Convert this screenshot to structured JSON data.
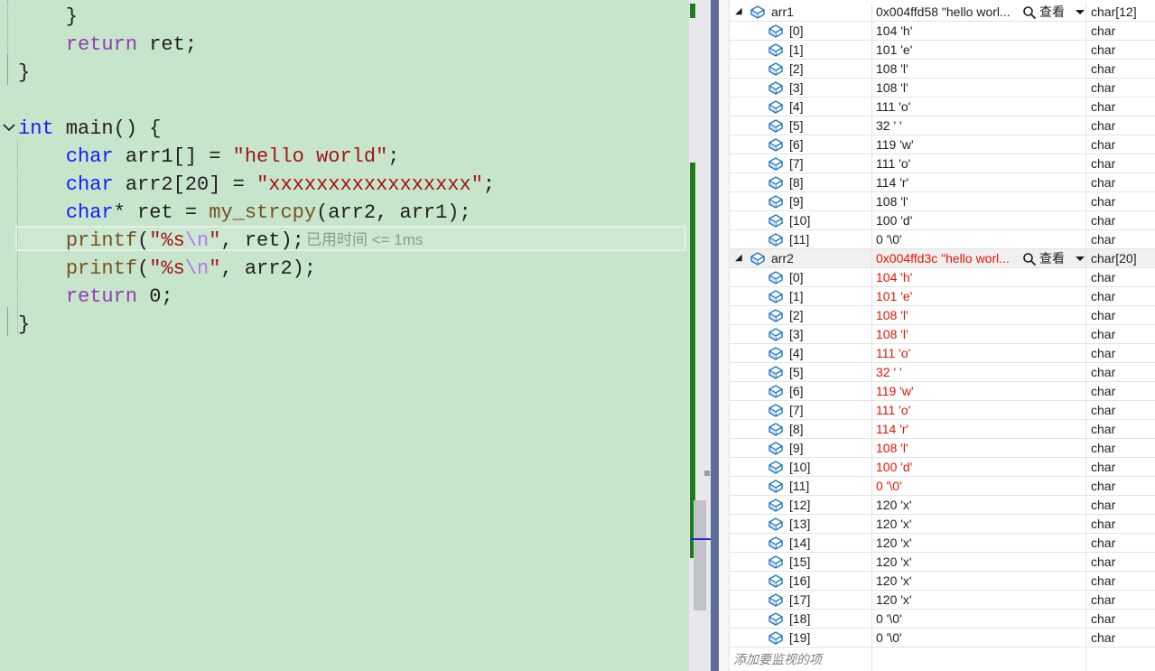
{
  "editor": {
    "lines": [
      [
        {
          "t": "    }",
          "c": "pl"
        }
      ],
      [
        {
          "t": "    ",
          "c": "pl"
        },
        {
          "t": "return",
          "c": "kw2"
        },
        {
          "t": " ret;",
          "c": "pl"
        }
      ],
      [
        {
          "t": "}",
          "c": "pl"
        }
      ],
      [
        {
          "t": "",
          "c": "pl"
        }
      ],
      [
        {
          "t": "int",
          "c": "kw"
        },
        {
          "t": " main() {",
          "c": "pl"
        }
      ],
      [
        {
          "t": "    ",
          "c": "pl"
        },
        {
          "t": "char",
          "c": "kw"
        },
        {
          "t": " arr1[] = ",
          "c": "pl"
        },
        {
          "t": "\"hello world\"",
          "c": "str"
        },
        {
          "t": ";",
          "c": "pl"
        }
      ],
      [
        {
          "t": "    ",
          "c": "pl"
        },
        {
          "t": "char",
          "c": "kw"
        },
        {
          "t": " arr2[20] = ",
          "c": "pl"
        },
        {
          "t": "\"xxxxxxxxxxxxxxxxx\"",
          "c": "str"
        },
        {
          "t": ";",
          "c": "pl"
        }
      ],
      [
        {
          "t": "    ",
          "c": "pl"
        },
        {
          "t": "char",
          "c": "kw"
        },
        {
          "t": "* ret = ",
          "c": "pl"
        },
        {
          "t": "my_strcpy",
          "c": "fn"
        },
        {
          "t": "(arr2, arr1);",
          "c": "pl"
        }
      ],
      [
        {
          "t": "    ",
          "c": "pl"
        },
        {
          "t": "printf",
          "c": "fn"
        },
        {
          "t": "(",
          "c": "pl"
        },
        {
          "t": "\"%s",
          "c": "str"
        },
        {
          "t": "\\n",
          "c": "esc"
        },
        {
          "t": "\"",
          "c": "str"
        },
        {
          "t": ", ret);",
          "c": "pl"
        }
      ],
      [
        {
          "t": "    ",
          "c": "pl"
        },
        {
          "t": "printf",
          "c": "fn"
        },
        {
          "t": "(",
          "c": "pl"
        },
        {
          "t": "\"%s",
          "c": "str"
        },
        {
          "t": "\\n",
          "c": "esc"
        },
        {
          "t": "\"",
          "c": "str"
        },
        {
          "t": ", arr2);",
          "c": "pl"
        }
      ],
      [
        {
          "t": "    ",
          "c": "pl"
        },
        {
          "t": "return",
          "c": "kw2"
        },
        {
          "t": " 0;",
          "c": "pl"
        }
      ],
      [
        {
          "t": "}",
          "c": "pl"
        }
      ]
    ],
    "perf_tip": "已用时间 <= 1ms",
    "colors": {
      "background": "#c7e5cb",
      "keyword": "#1919ff",
      "control_keyword": "#8f3fb1",
      "function": "#74531f",
      "string": "#a31515",
      "escape": "#b776fb"
    }
  },
  "watch": {
    "view_label": "查看",
    "add_placeholder": "添加要监视的项",
    "changed_color": "#e51400",
    "rows": [
      {
        "level": 0,
        "expanded": true,
        "name": "arr1",
        "value": "0x004ffd58 \"hello worl...",
        "type": "char[12]",
        "view": true,
        "changed": false
      },
      {
        "level": 1,
        "name": "[0]",
        "value": "104 'h'",
        "type": "char",
        "changed": false
      },
      {
        "level": 1,
        "name": "[1]",
        "value": "101 'e'",
        "type": "char",
        "changed": false
      },
      {
        "level": 1,
        "name": "[2]",
        "value": "108 'l'",
        "type": "char",
        "changed": false
      },
      {
        "level": 1,
        "name": "[3]",
        "value": "108 'l'",
        "type": "char",
        "changed": false
      },
      {
        "level": 1,
        "name": "[4]",
        "value": "111 'o'",
        "type": "char",
        "changed": false
      },
      {
        "level": 1,
        "name": "[5]",
        "value": "32 ' '",
        "type": "char",
        "changed": false
      },
      {
        "level": 1,
        "name": "[6]",
        "value": "119 'w'",
        "type": "char",
        "changed": false
      },
      {
        "level": 1,
        "name": "[7]",
        "value": "111 'o'",
        "type": "char",
        "changed": false
      },
      {
        "level": 1,
        "name": "[8]",
        "value": "114 'r'",
        "type": "char",
        "changed": false
      },
      {
        "level": 1,
        "name": "[9]",
        "value": "108 'l'",
        "type": "char",
        "changed": false
      },
      {
        "level": 1,
        "name": "[10]",
        "value": "100 'd'",
        "type": "char",
        "changed": false
      },
      {
        "level": 1,
        "name": "[11]",
        "value": "0 '\\0'",
        "type": "char",
        "changed": false
      },
      {
        "level": 0,
        "expanded": true,
        "selected": true,
        "name": "arr2",
        "value": "0x004ffd3c \"hello worl...",
        "type": "char[20]",
        "view": true,
        "changed": true
      },
      {
        "level": 1,
        "name": "[0]",
        "value": "104 'h'",
        "type": "char",
        "changed": true
      },
      {
        "level": 1,
        "name": "[1]",
        "value": "101 'e'",
        "type": "char",
        "changed": true
      },
      {
        "level": 1,
        "name": "[2]",
        "value": "108 'l'",
        "type": "char",
        "changed": true
      },
      {
        "level": 1,
        "name": "[3]",
        "value": "108 'l'",
        "type": "char",
        "changed": true
      },
      {
        "level": 1,
        "name": "[4]",
        "value": "111 'o'",
        "type": "char",
        "changed": true
      },
      {
        "level": 1,
        "name": "[5]",
        "value": "32 ' '",
        "type": "char",
        "changed": true
      },
      {
        "level": 1,
        "name": "[6]",
        "value": "119 'w'",
        "type": "char",
        "changed": true
      },
      {
        "level": 1,
        "name": "[7]",
        "value": "111 'o'",
        "type": "char",
        "changed": true
      },
      {
        "level": 1,
        "name": "[8]",
        "value": "114 'r'",
        "type": "char",
        "changed": true
      },
      {
        "level": 1,
        "name": "[9]",
        "value": "108 'l'",
        "type": "char",
        "changed": true
      },
      {
        "level": 1,
        "name": "[10]",
        "value": "100 'd'",
        "type": "char",
        "changed": true
      },
      {
        "level": 1,
        "name": "[11]",
        "value": "0 '\\0'",
        "type": "char",
        "changed": true
      },
      {
        "level": 1,
        "name": "[12]",
        "value": "120 'x'",
        "type": "char",
        "changed": false
      },
      {
        "level": 1,
        "name": "[13]",
        "value": "120 'x'",
        "type": "char",
        "changed": false
      },
      {
        "level": 1,
        "name": "[14]",
        "value": "120 'x'",
        "type": "char",
        "changed": false
      },
      {
        "level": 1,
        "name": "[15]",
        "value": "120 'x'",
        "type": "char",
        "changed": false
      },
      {
        "level": 1,
        "name": "[16]",
        "value": "120 'x'",
        "type": "char",
        "changed": false
      },
      {
        "level": 1,
        "name": "[17]",
        "value": "120 'x'",
        "type": "char",
        "changed": false
      },
      {
        "level": 1,
        "name": "[18]",
        "value": "0 '\\0'",
        "type": "char",
        "changed": false
      },
      {
        "level": 1,
        "name": "[19]",
        "value": "0 '\\0'",
        "type": "char",
        "changed": false
      }
    ]
  }
}
